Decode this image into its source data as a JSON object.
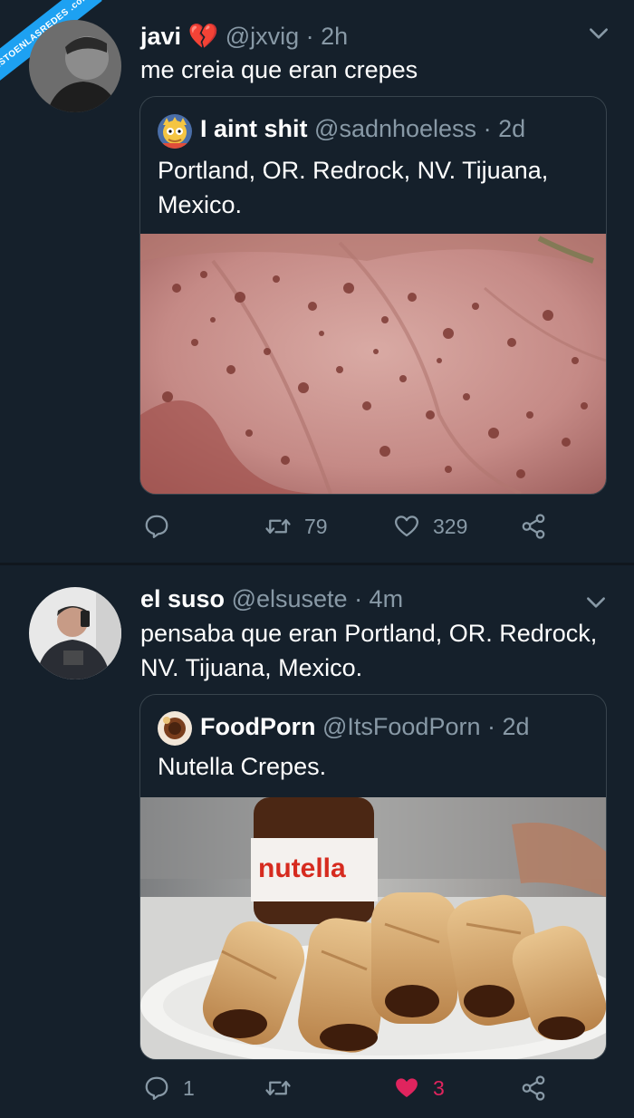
{
  "watermark": {
    "text": "VISTOENLASREDES .com"
  },
  "tweet1": {
    "name": "javi",
    "emoji": "💔",
    "handle": "@jxvig",
    "time": "· 2h",
    "text": "me creia que eran crepes",
    "quote": {
      "name": "I aint shit",
      "handle": "@sadnhoeless",
      "time": "· 2d",
      "text": "Portland, OR. Redrock, NV. Tijuana, Mexico."
    },
    "actions": {
      "replies": "",
      "retweets": "79",
      "likes": "329"
    }
  },
  "tweet2": {
    "name": "el suso",
    "handle": "@elsusete",
    "time": "· 4m",
    "text": "pensaba que eran Portland, OR. Redrock, NV. Tijuana, Mexico.",
    "quote": {
      "name": "FoodPorn",
      "handle": "@ItsFoodPorn",
      "time": "· 2d",
      "text": "Nutella Crepes.",
      "jar_label": "nutella"
    },
    "actions": {
      "replies": "1",
      "retweets": "",
      "likes": "3"
    }
  },
  "colors": {
    "background": "#15202b",
    "muted": "#8899a6",
    "like": "#e0245e",
    "border": "#38444d"
  }
}
